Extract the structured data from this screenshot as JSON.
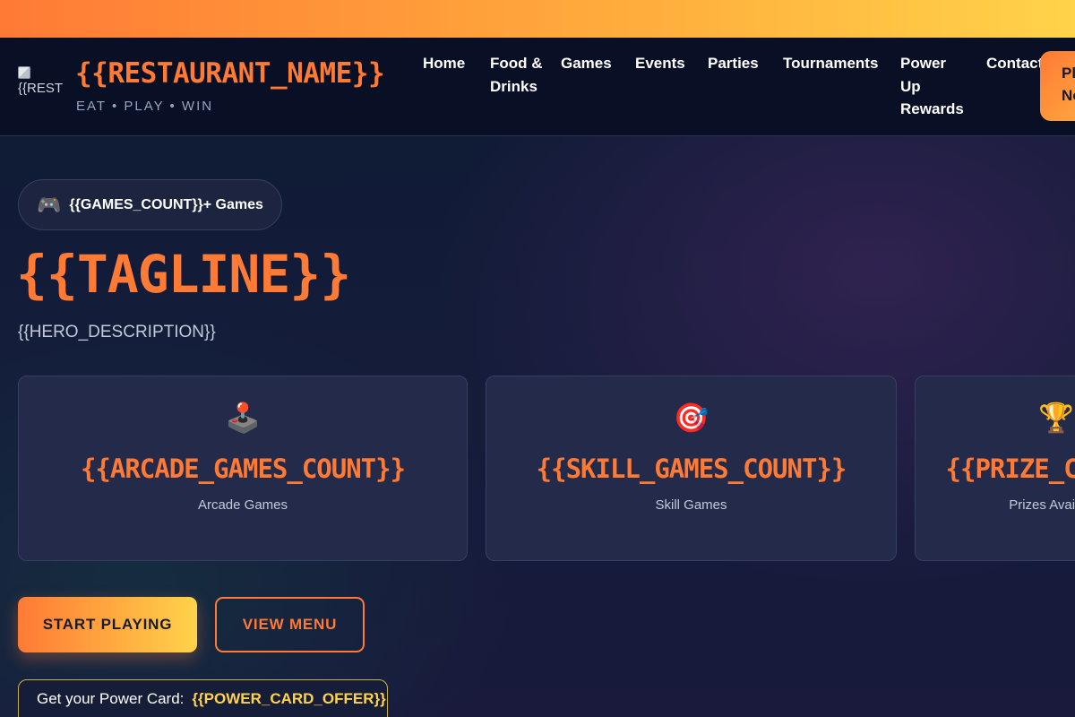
{
  "colors": {
    "accent": "#ff7a35",
    "accent_gold": "#ffd34a",
    "background": "#0d1a33",
    "card": "#232a4a"
  },
  "brand": {
    "logo_alt": "{{RESTAURANT_NAME}} logo",
    "logo_visible_text": "{{REST",
    "name": "{{RESTAURANT_NAME}}",
    "tagline": "EAT • PLAY • WIN"
  },
  "nav": {
    "items": [
      {
        "label": "Home"
      },
      {
        "label": "Food & Drinks"
      },
      {
        "label": "Games"
      },
      {
        "label": "Events"
      },
      {
        "label": "Parties"
      },
      {
        "label": "Tournaments"
      },
      {
        "label": "Power Up Rewards"
      },
      {
        "label": "Contact"
      }
    ],
    "cta_label": "Play Now"
  },
  "hero": {
    "games_badge": {
      "icon": "video-game-controller",
      "icon_glyph": "🎮",
      "label": "{{GAMES_COUNT}}+ Games"
    },
    "title": "{{TAGLINE}}",
    "description": "{{HERO_DESCRIPTION}}",
    "stats": [
      {
        "icon": "joystick",
        "icon_glyph": "🕹️",
        "value": "{{ARCADE_GAMES_COUNT}}",
        "label": "Arcade Games"
      },
      {
        "icon": "direct-hit-target",
        "icon_glyph": "🎯",
        "value": "{{SKILL_GAMES_COUNT}}",
        "label": "Skill Games"
      },
      {
        "icon": "trophy",
        "icon_glyph": "🏆",
        "value": "{{PRIZE_COUNT}}",
        "label": "Prizes Available"
      }
    ],
    "primary_button": "START PLAYING",
    "secondary_button": "VIEW MENU",
    "offer": {
      "label": "Get your Power Card:",
      "value": "{{POWER_CARD_OFFER}}"
    }
  }
}
